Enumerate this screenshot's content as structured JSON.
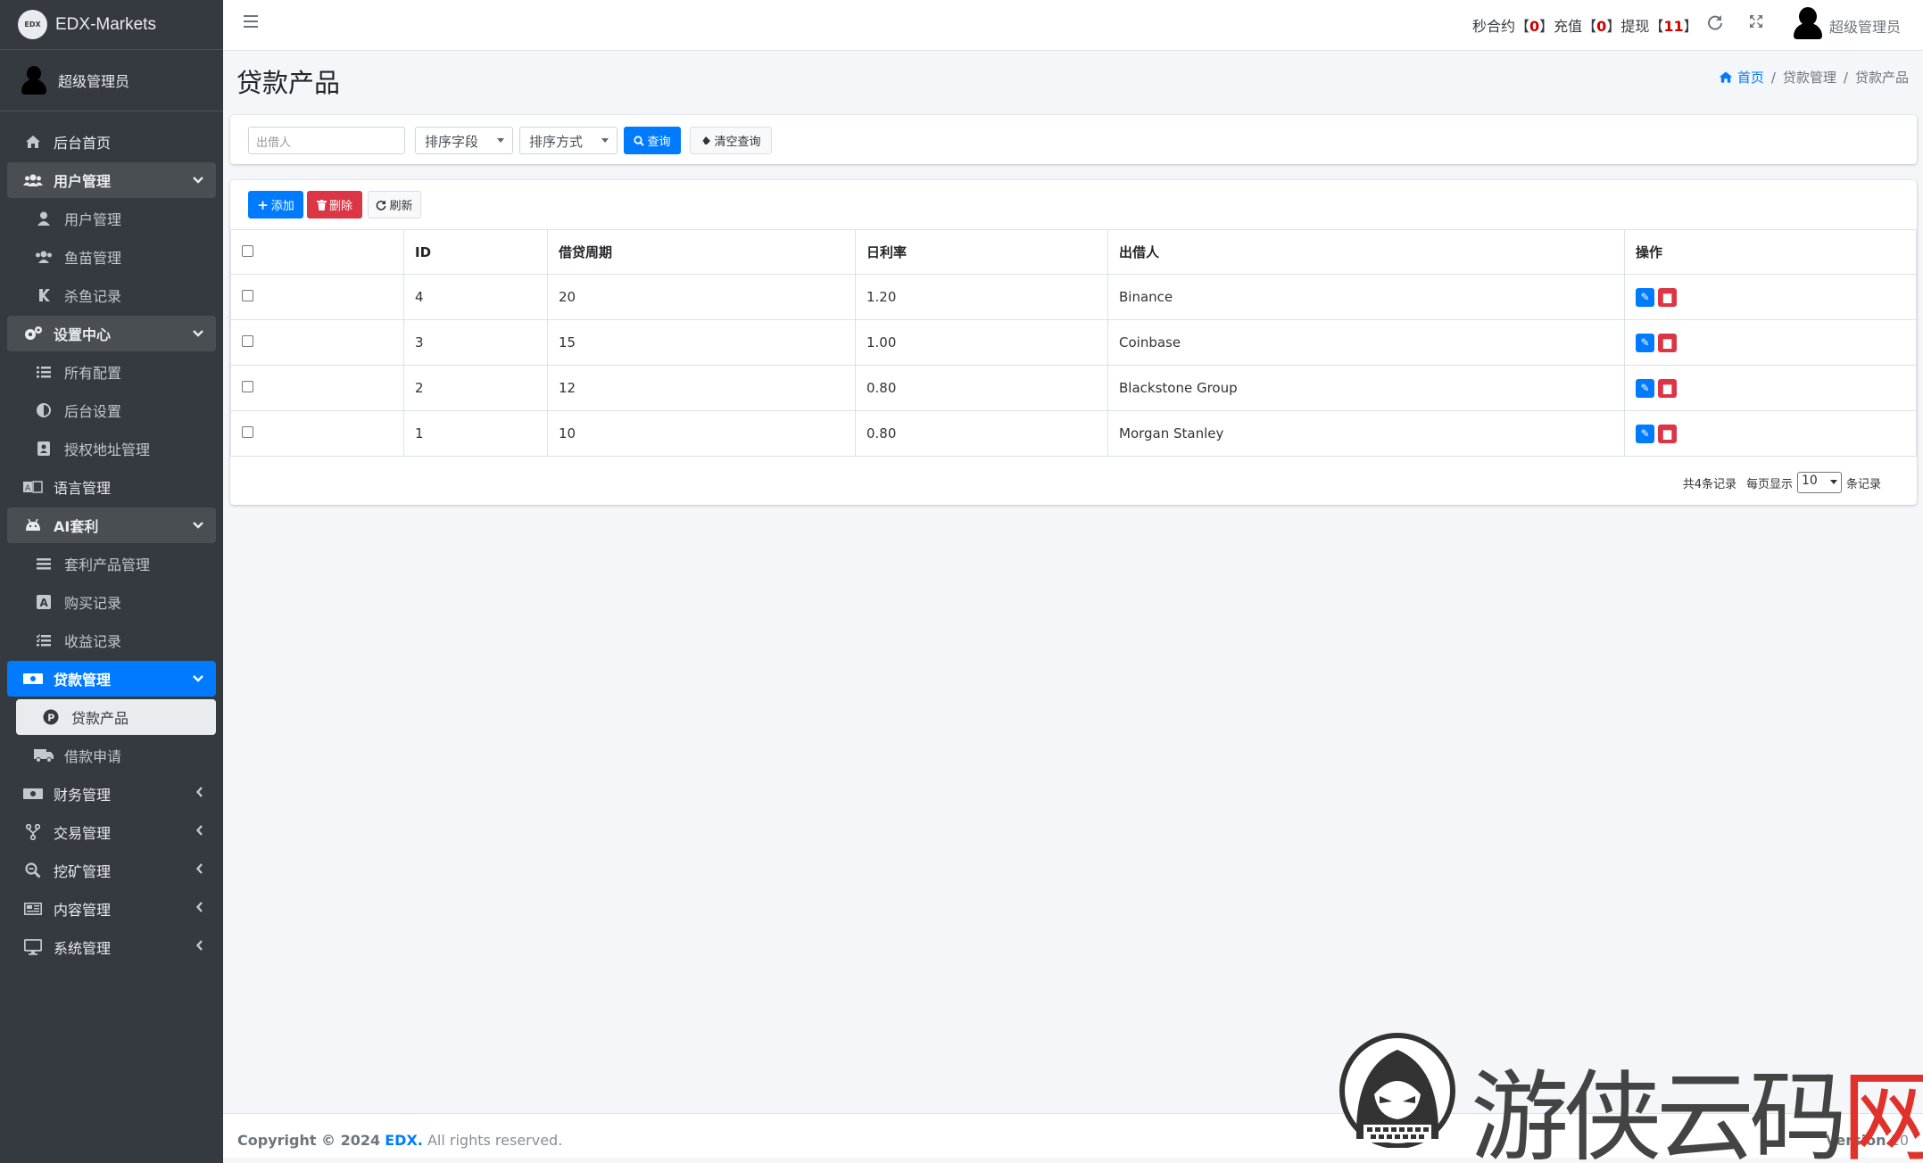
{
  "brand": {
    "logo_text": "EDX",
    "name": "EDX-Markets"
  },
  "sidebar": {
    "user": "超级管理员",
    "items": [
      {
        "label": "后台首页",
        "icon": "home-icon"
      },
      {
        "label": "用户管理",
        "icon": "users-icon"
      },
      {
        "label": "用户管理",
        "icon": "user-icon"
      },
      {
        "label": "鱼苗管理",
        "icon": "users-icon"
      },
      {
        "label": "杀鱼记录",
        "icon": "k-icon"
      },
      {
        "label": "设置中心",
        "icon": "cogs-icon"
      },
      {
        "label": "所有配置",
        "icon": "list-icon"
      },
      {
        "label": "后台设置",
        "icon": "adjust-icon"
      },
      {
        "label": "授权地址管理",
        "icon": "id-card-icon"
      },
      {
        "label": "语言管理",
        "icon": "language-icon"
      },
      {
        "label": "AI套利",
        "icon": "android-icon"
      },
      {
        "label": "套利产品管理",
        "icon": "bars-icon"
      },
      {
        "label": "购买记录",
        "icon": "a-square-icon"
      },
      {
        "label": "收益记录",
        "icon": "list-check-icon"
      },
      {
        "label": "贷款管理",
        "icon": "money-icon"
      },
      {
        "label": "贷款产品",
        "icon": "p-circle-icon"
      },
      {
        "label": "借款申请",
        "icon": "truck-icon"
      },
      {
        "label": "财务管理",
        "icon": "money-icon"
      },
      {
        "label": "交易管理",
        "icon": "code-fork-icon"
      },
      {
        "label": "挖矿管理",
        "icon": "search-minus-icon"
      },
      {
        "label": "内容管理",
        "icon": "newspaper-icon"
      },
      {
        "label": "系统管理",
        "icon": "desktop-icon"
      }
    ]
  },
  "topbar": {
    "stat_prefix_1": "秒合约【",
    "stat_val_1": "0",
    "stat_prefix_2": "】充值【",
    "stat_val_2": "0",
    "stat_prefix_3": "】提现【",
    "stat_val_3": "11",
    "stat_suffix": "】",
    "user": "超级管理员"
  },
  "page": {
    "title": "贷款产品",
    "breadcrumb": [
      "首页",
      "贷款管理",
      "贷款产品"
    ]
  },
  "search": {
    "lender_placeholder": "出借人",
    "sort_field": "排序字段",
    "sort_order": "排序方式",
    "query_label": "查询",
    "clear_label": "清空查询"
  },
  "toolbar": {
    "add_label": "添加",
    "delete_label": "删除",
    "refresh_label": "刷新"
  },
  "table": {
    "headers": [
      "",
      "ID",
      "借贷周期",
      "日利率",
      "出借人",
      "操作"
    ],
    "rows": [
      {
        "id": "4",
        "period": "20",
        "rate": "1.20",
        "lender": "Binance"
      },
      {
        "id": "3",
        "period": "15",
        "rate": "1.00",
        "lender": "Coinbase"
      },
      {
        "id": "2",
        "period": "12",
        "rate": "0.80",
        "lender": "Blackstone Group"
      },
      {
        "id": "1",
        "period": "10",
        "rate": "0.80",
        "lender": "Morgan Stanley"
      }
    ]
  },
  "pager": {
    "total": "共4条记录",
    "per_page_label": "每页显示",
    "per_page": "10",
    "suffix": "条记录"
  },
  "footer": {
    "copyright": "Copyright © 2024",
    "company": "EDX.",
    "rights": "All rights reserved.",
    "version_label": "Version",
    "version": "10"
  },
  "watermark": {
    "text_main": "游侠云码",
    "text_red": "网"
  },
  "colors": {
    "primary": "#007bff",
    "danger": "#dc3545",
    "sidebar_bg": "#343a40"
  }
}
